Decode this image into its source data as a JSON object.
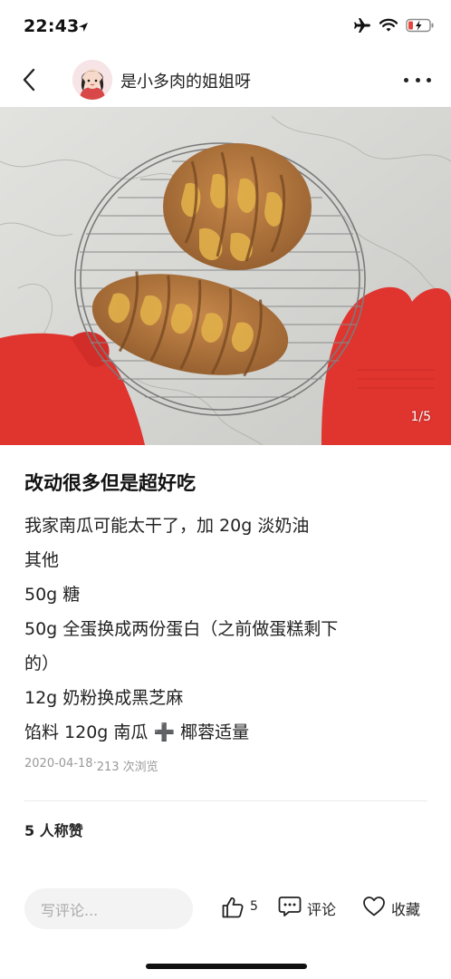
{
  "status_bar": {
    "time": "22:43"
  },
  "nav": {
    "author_name": "是小多肉的姐姐呀"
  },
  "photo": {
    "page_indicator": "1/5"
  },
  "post": {
    "title": "改动很多但是超好吃",
    "lines": [
      "我家南瓜可能太干了，加 20g 淡奶油",
      "其他",
      "50g 糖",
      "50g 全蛋换成两份蛋白（之前做蛋糕剩下",
      "的）",
      "12g 奶粉换成黑芝麻",
      "馅料 120g 南瓜 ➕ 椰蓉适量"
    ],
    "date": "2020-04-18",
    "separator": "·",
    "views": "213 次浏览"
  },
  "likes": {
    "text": "5 人称赞"
  },
  "bottom_bar": {
    "comment_placeholder": "写评论...",
    "like_count": "5",
    "comment_label": "评论",
    "collect_label": "收藏"
  },
  "icons": {
    "location": "location-arrow-icon",
    "airplane": "airplane-icon",
    "wifi": "wifi-icon",
    "battery": "battery-low-charging-icon",
    "back": "back-chevron-icon",
    "more": "more-dots-icon",
    "like": "thumbs-up-icon",
    "comment": "comment-bubble-icon",
    "collect": "heart-icon"
  },
  "colors": {
    "battery_low": "#e8453c",
    "oven_mitt": "#e0342f",
    "bread": "#b5743a"
  }
}
